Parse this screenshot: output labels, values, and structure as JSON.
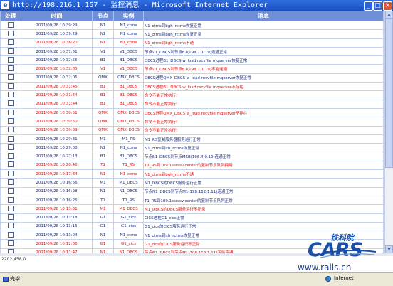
{
  "window": {
    "title": "http://198.216.1.157 - 监控消息 - Microsoft Internet Explorer",
    "icon": "ie-icon",
    "controls": {
      "minimize": "_",
      "maximize": "□",
      "close": "×"
    }
  },
  "table": {
    "headers": {
      "select": "处理",
      "time": "时间",
      "node": "节点",
      "instance": "实例",
      "message": "消息"
    },
    "rows": [
      {
        "time": "2011/09/28 10:39:29",
        "node": "N1",
        "instance": "N1_ctms",
        "message": "N1_ctms到bgh_rctms恢复正常",
        "red": false
      },
      {
        "time": "2011/09/28 10:39:29",
        "node": "N1",
        "instance": "N1_ctms",
        "message": "N1_ctms到bgh_rctms恢复正常",
        "red": false
      },
      {
        "time": "2011/09/28 10:38:20",
        "node": "N1",
        "instance": "N1_ctms",
        "message": "N1_ctms到bgh_rctms不通",
        "red": true
      },
      {
        "time": "2011/09/28 10:37:51",
        "node": "V1",
        "instance": "V1_DBCS",
        "message": "节点V1_DBCS到节点B1(198.1.1.19)连通正常",
        "red": false
      },
      {
        "time": "2011/09/28 10:32:55",
        "node": "B1",
        "instance": "B1_DBCS",
        "message": "DBCS进程B1_DBCS w_load recvfile mqserver恢复正常",
        "red": false
      },
      {
        "time": "2011/09/28 10:32:05",
        "node": "V1",
        "instance": "V1_DBCS",
        "message": "节点V1_DBCS到节点B1(198.1.1.19)不能连通",
        "red": true
      },
      {
        "time": "2011/09/28 10:32:05",
        "node": "QMX",
        "instance": "QMX_DBCS",
        "message": "DBCS进程QMX_DBCS w_load recvfile mqserver恢复正常",
        "red": false
      },
      {
        "time": "2011/09/28 10:31:45",
        "node": "B1",
        "instance": "B1_DBCS",
        "message": "DBCS进程B1_DBCS w_load recvfile mqserver不存在",
        "red": true
      },
      {
        "time": "2011/09/28 10:31:44",
        "node": "B1",
        "instance": "B1_DBCS",
        "message": "命令不能正常执行!",
        "red": true
      },
      {
        "time": "2011/09/28 10:31:44",
        "node": "B1",
        "instance": "B1_DBCS",
        "message": "命令不能正常执行!",
        "red": true
      },
      {
        "time": "2011/09/28 10:30:51",
        "node": "QMX",
        "instance": "QMX_DBCS",
        "message": "DBCS进程QMX_DBCS w_load recvfile mqserver不存在",
        "red": true
      },
      {
        "time": "2011/09/28 10:30:50",
        "node": "QMX",
        "instance": "QMX_DBCS",
        "message": "命令不能正常执行!",
        "red": true
      },
      {
        "time": "2011/09/28 10:30:39",
        "node": "QMX",
        "instance": "QMX_DBCS",
        "message": "命令不能正常执行!",
        "red": true
      },
      {
        "time": "2011/09/28 10:29:31",
        "node": "M1",
        "instance": "M1_RS",
        "message": "M1_RS复制服务器服务运行正常",
        "red": false
      },
      {
        "time": "2011/09/28 10:29:08",
        "node": "N1",
        "instance": "N1_ctms",
        "message": "N1_ctms到ith_rctms恢复正常",
        "red": false
      },
      {
        "time": "2011/09/28 10:27:13",
        "node": "B1",
        "instance": "B1_DBCS",
        "message": "节点B1_DBCS到节点MSB(198.4.0.19)连通正常",
        "red": false
      },
      {
        "time": "2011/09/28 10:20:46",
        "node": "T1",
        "instance": "T1_RS",
        "message": "T1_RS到109.1ssrssv.center的复制节点队列拥堵",
        "red": true
      },
      {
        "time": "2011/09/28 10:17:34",
        "node": "N1",
        "instance": "N1_ctms",
        "message": "N1_ctms到bgh_rctms不通",
        "red": true
      },
      {
        "time": "2011/09/28 10:16:56",
        "node": "M1",
        "instance": "M1_DBCS",
        "message": "M1_DBCS的DBCS服务运行正常",
        "red": false
      },
      {
        "time": "2011/09/28 10:16:28",
        "node": "N1",
        "instance": "N1_DBCS",
        "message": "节点N1_DBCS到节点M1(198.112.1.11)连通正常",
        "red": false
      },
      {
        "time": "2011/09/28 10:16:25",
        "node": "T1",
        "instance": "T1_RS",
        "message": "T1_RS到109.1ssrssv.center的复制节点队列正常",
        "red": false
      },
      {
        "time": "2011/09/28 10:13:31",
        "node": "M1",
        "instance": "M1_DBCS",
        "message": "M1_DBCS的DBCS服务运行不正常",
        "red": true
      },
      {
        "time": "2011/09/28 10:13:18",
        "node": "G1",
        "instance": "G1_cics",
        "message": "CICS进程G1_cics正常",
        "red": false
      },
      {
        "time": "2011/09/28 10:13:15",
        "node": "G1",
        "instance": "G1_cics",
        "message": "G1_cics的CICS服务运行正常",
        "red": false
      },
      {
        "time": "2011/09/28 10:13:04",
        "node": "N1",
        "instance": "N1_ctms",
        "message": "N1_ctms到ith_rctms恢复正常",
        "red": false
      },
      {
        "time": "2011/09/28 10:12:06",
        "node": "G1",
        "instance": "G1_cics",
        "message": "G1_cics的CICS服务运行不正常",
        "red": true
      },
      {
        "time": "2011/09/28 10:11:47",
        "node": "N1",
        "instance": "N1_DBCS",
        "message": "节点N1_DBCS到节点M1(198.112.1.11)不能连通",
        "red": true
      }
    ]
  },
  "coords": "2202,458,0",
  "status": {
    "text": "完毕",
    "zone": "Internet"
  },
  "logo": {
    "chinese": "铁科院",
    "brand": "CARS",
    "url": "www.rails.cn"
  },
  "colors": {
    "header": "#6f8fd7",
    "alert": "#e01010",
    "normal": "#1c2f7f",
    "brand": "#1a4faa"
  }
}
